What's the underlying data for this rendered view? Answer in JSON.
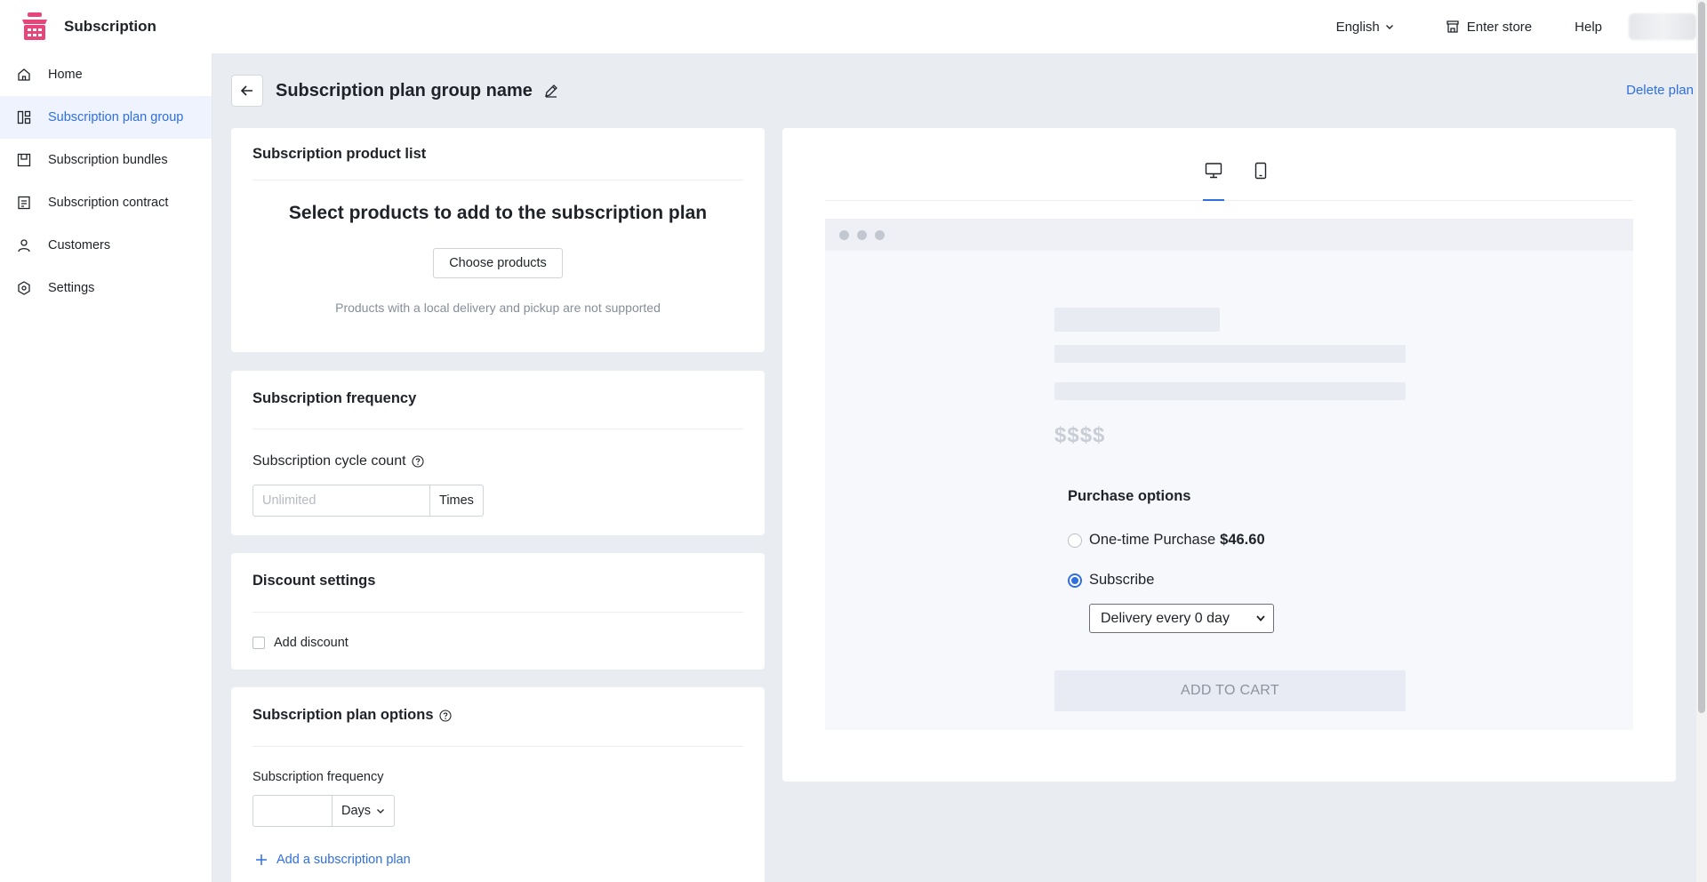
{
  "app": {
    "name": "Subscription",
    "brand_color": "#e8457a",
    "accent_color": "#2f6fe0"
  },
  "topbar": {
    "language": "English",
    "enter_store": "Enter store",
    "help": "Help"
  },
  "sidebar": {
    "items": [
      {
        "label": "Home",
        "icon": "home-icon",
        "active": false
      },
      {
        "label": "Subscription plan group",
        "icon": "grid-icon",
        "active": true
      },
      {
        "label": "Subscription bundles",
        "icon": "bundle-icon",
        "active": false
      },
      {
        "label": "Subscription contract",
        "icon": "document-icon",
        "active": false
      },
      {
        "label": "Customers",
        "icon": "user-icon",
        "active": false
      },
      {
        "label": "Settings",
        "icon": "gear-icon",
        "active": false
      }
    ]
  },
  "page": {
    "title": "Subscription plan group name",
    "delete_label": "Delete plan"
  },
  "product_list": {
    "title": "Subscription product list",
    "heading": "Select products to add to the subscription plan",
    "choose_button": "Choose products",
    "hint": "Products with a local delivery and pickup are not supported"
  },
  "frequency": {
    "title": "Subscription frequency",
    "cycle_label": "Subscription cycle count",
    "cycle_placeholder": "Unlimited",
    "cycle_value": "",
    "cycle_unit": "Times"
  },
  "discount": {
    "title": "Discount settings",
    "add_discount": "Add discount",
    "checked": false
  },
  "plan_options": {
    "title": "Subscription plan options",
    "frequency_label": "Subscription frequency",
    "frequency_value": "",
    "frequency_unit": "Days",
    "add_plan": "Add a subscription plan"
  },
  "preview": {
    "price_placeholder": "$$$$",
    "purchase_options_title": "Purchase options",
    "one_time_label": "One-time Purchase",
    "one_time_price": "$46.60",
    "subscribe_label": "Subscribe",
    "selected_option": "Subscribe",
    "delivery_select": "Delivery every 0 day",
    "add_to_cart": "ADD TO CART",
    "active_device": "desktop"
  }
}
